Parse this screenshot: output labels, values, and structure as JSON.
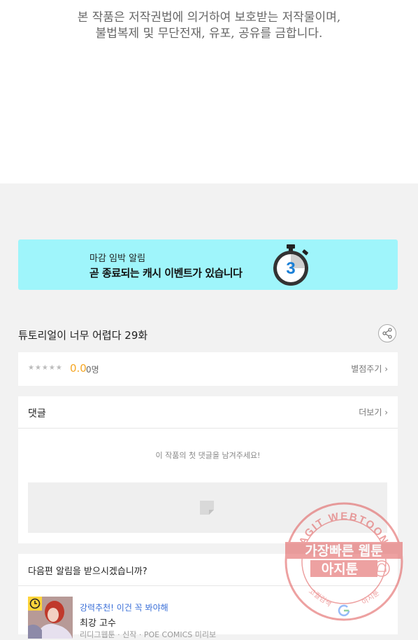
{
  "copyright": {
    "line1": "본 작품은 저작권법에 의거하여 보호받는 저작물이며,",
    "line2": "불법복제 및 무단전재, 유포, 공유를 금합니다."
  },
  "banner": {
    "small_text": "마감 임박 알림",
    "big_text": "곧 종료되는 캐시 이벤트가 있습니다",
    "timer_number": "3",
    "background": "#9ff5fb"
  },
  "episode": {
    "title": "튜토리얼이 너무 어렵다 29화",
    "share_icon": "share-icon"
  },
  "rating": {
    "stars": "★★★★★",
    "score": "0.0",
    "count": "0명",
    "rate_link": "별점주기 ›"
  },
  "comments": {
    "title": "댓글",
    "more": "더보기 ›",
    "empty_message": "이 작품의 첫 댓글을 남겨주세요!"
  },
  "notify": {
    "title": "다음편 알림을 받으시겠습니까?"
  },
  "recommend": {
    "tag": "강력추천! 이건 꼭 봐야해",
    "name": "최강 고수",
    "meta": "리디그웹툰 · 신작 · POE COMICS 미리보"
  },
  "watermark": {
    "arc_text": "AGIT WEBTOON",
    "line1": "가장빠른 웹툰",
    "line2": "아지툰",
    "bottom_left": "고퀄검색",
    "bottom_right": "아지툰"
  },
  "colors": {
    "accent_yellow": "#f5a623",
    "link_blue": "#3a6fd8",
    "banner_cyan": "#9ff5fb",
    "stamp_red": "#e05555"
  }
}
